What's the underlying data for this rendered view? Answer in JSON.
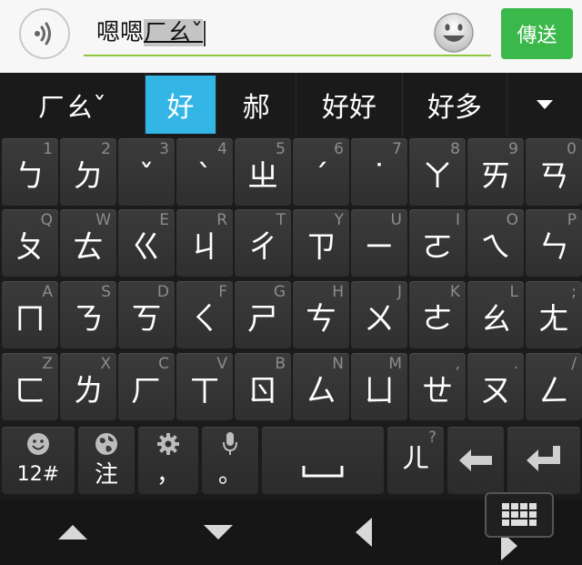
{
  "input_bar": {
    "committed_text": "嗯嗯",
    "composing_text": "ㄏㄠˇ",
    "send_label": "傳送"
  },
  "candidates": [
    "ㄏㄠˇ",
    "好",
    "郝",
    "好好",
    "好多"
  ],
  "keyboard": {
    "rows": [
      [
        {
          "hint": "1",
          "label": "ㄅ"
        },
        {
          "hint": "2",
          "label": "ㄉ"
        },
        {
          "hint": "3",
          "label": "ˇ"
        },
        {
          "hint": "4",
          "label": "ˋ"
        },
        {
          "hint": "5",
          "label": "ㄓ"
        },
        {
          "hint": "6",
          "label": "ˊ"
        },
        {
          "hint": "7",
          "label": "˙"
        },
        {
          "hint": "8",
          "label": "ㄚ"
        },
        {
          "hint": "9",
          "label": "ㄞ"
        },
        {
          "hint": "0",
          "label": "ㄢ"
        }
      ],
      [
        {
          "hint": "Q",
          "label": "ㄆ"
        },
        {
          "hint": "W",
          "label": "ㄊ"
        },
        {
          "hint": "E",
          "label": "ㄍ"
        },
        {
          "hint": "R",
          "label": "ㄐ"
        },
        {
          "hint": "T",
          "label": "ㄔ"
        },
        {
          "hint": "Y",
          "label": "ㄗ"
        },
        {
          "hint": "U",
          "label": "ㄧ"
        },
        {
          "hint": "I",
          "label": "ㄛ"
        },
        {
          "hint": "O",
          "label": "ㄟ"
        },
        {
          "hint": "P",
          "label": "ㄣ"
        }
      ],
      [
        {
          "hint": "A",
          "label": "ㄇ"
        },
        {
          "hint": "S",
          "label": "ㄋ"
        },
        {
          "hint": "D",
          "label": "ㄎ"
        },
        {
          "hint": "F",
          "label": "ㄑ"
        },
        {
          "hint": "G",
          "label": "ㄕ"
        },
        {
          "hint": "H",
          "label": "ㄘ"
        },
        {
          "hint": "J",
          "label": "ㄨ"
        },
        {
          "hint": "K",
          "label": "ㄜ"
        },
        {
          "hint": "L",
          "label": "ㄠ"
        },
        {
          "hint": ";",
          "label": "ㄤ"
        }
      ],
      [
        {
          "hint": "Z",
          "label": "ㄈ"
        },
        {
          "hint": "X",
          "label": "ㄌ"
        },
        {
          "hint": "C",
          "label": "ㄏ"
        },
        {
          "hint": "V",
          "label": "ㄒ"
        },
        {
          "hint": "B",
          "label": "ㄖ"
        },
        {
          "hint": "N",
          "label": "ㄙ"
        },
        {
          "hint": "M",
          "label": "ㄩ"
        },
        {
          "hint": ",",
          "label": "ㄝ"
        },
        {
          "hint": ".",
          "label": "ㄡ"
        },
        {
          "hint": "/",
          "label": "ㄥ"
        }
      ]
    ],
    "function_row": {
      "symbols_label": "12#",
      "zhuyin_label": "注",
      "comma_label": "，",
      "period_label": "。",
      "er_hint": "?",
      "er_label": "ㄦ"
    }
  },
  "icons": {
    "voice": "voice-input-icon",
    "emoji": "smiley-icon",
    "expand": "expand-candidates-icon",
    "backspace": "backspace-icon",
    "enter": "enter-icon",
    "space": "space-bar-icon",
    "nav_up": "triangle-up-icon",
    "nav_down": "triangle-down-icon",
    "nav_back": "back-icon",
    "nav_forward": "forward-icon",
    "keyboard_switch": "keyboard-icon"
  },
  "colors": {
    "send_button": "#3bb84a",
    "candidate_highlight": "#33b5e5",
    "input_underline": "#8cc63f"
  }
}
